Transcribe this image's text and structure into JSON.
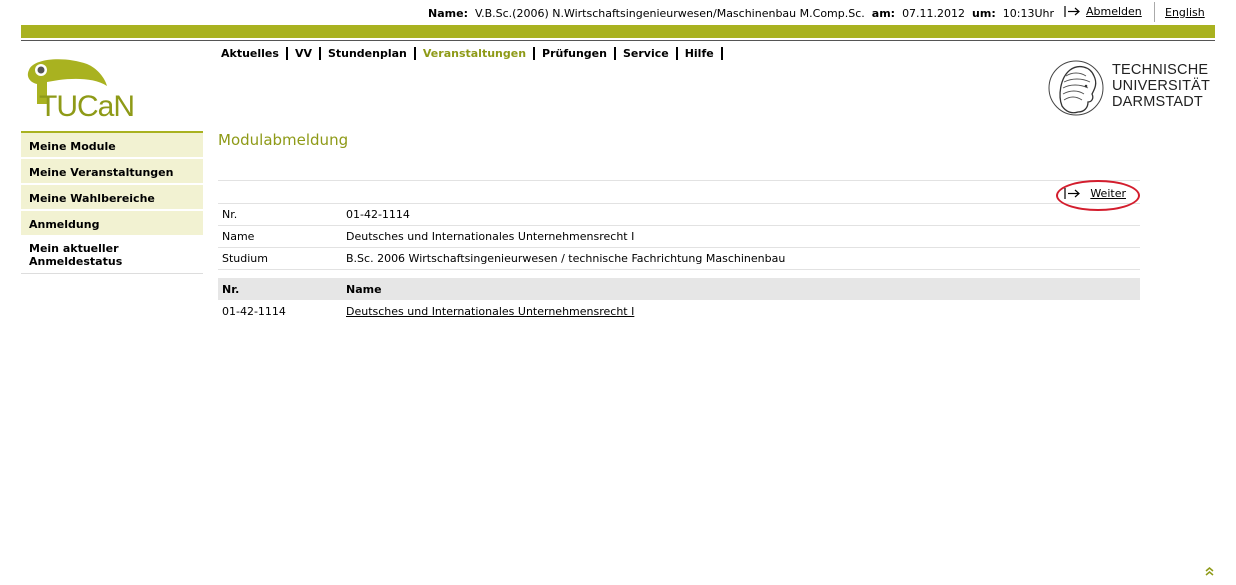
{
  "header": {
    "name_label": "Name:",
    "name_value": "V.B.Sc.(2006) N.Wirtschaftsingenieurwesen/Maschinenbau M.Comp.Sc.",
    "date_label": "am:",
    "date_value": "07.11.2012",
    "time_label": "um:",
    "time_value": "10:13Uhr",
    "logout_label": "Abmelden",
    "language_label": "English"
  },
  "logo": {
    "text": "TUCaN"
  },
  "tu_logo": {
    "line1": "TECHNISCHE",
    "line2": "UNIVERSITÄT",
    "line3": "DARMSTADT"
  },
  "topmenu": {
    "items": [
      {
        "label": "Aktuelles",
        "active": false
      },
      {
        "label": "VV",
        "active": false
      },
      {
        "label": "Stundenplan",
        "active": false
      },
      {
        "label": "Veranstaltungen",
        "active": true
      },
      {
        "label": "Prüfungen",
        "active": false
      },
      {
        "label": "Service",
        "active": false
      },
      {
        "label": "Hilfe",
        "active": false
      }
    ]
  },
  "sidebar": {
    "items": [
      {
        "label": "Meine Module"
      },
      {
        "label": "Meine Veranstaltungen"
      },
      {
        "label": "Meine Wahlbereiche"
      },
      {
        "label": "Anmeldung"
      },
      {
        "label": "Mein aktueller Anmeldestatus"
      }
    ]
  },
  "main": {
    "title": "Modulabmeldung",
    "continue_label": "Weiter",
    "details": [
      {
        "label": "Nr.",
        "value": "01-42-1114"
      },
      {
        "label": "Name",
        "value": "Deutsches und Internationales Unternehmensrecht I"
      },
      {
        "label": "Studium",
        "value": "B.Sc. 2006 Wirtschaftsingenieurwesen / technische Fachrichtung Maschinenbau"
      }
    ],
    "table": {
      "headers": [
        "Nr.",
        "Name"
      ],
      "rows": [
        {
          "nr": "01-42-1114",
          "name": "Deutsches und Internationales Unternehmensrecht I"
        }
      ]
    }
  },
  "colors": {
    "accent_green": "#a9b220",
    "title_green": "#8e9a17",
    "nav_bg": "#f2f2d2",
    "highlight_circle": "#d31d2d"
  },
  "icons": {
    "logout": "arrow-right-icon",
    "continue": "arrow-right-icon",
    "back_to_top": "chevron-double-up-icon"
  }
}
